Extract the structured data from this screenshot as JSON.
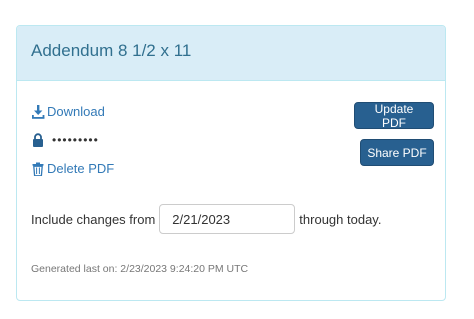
{
  "panel": {
    "title": "Addendum 8 1/2 x 11"
  },
  "links": {
    "download_label": "Download",
    "password_masked": "•••••••••",
    "delete_label": "Delete PDF"
  },
  "buttons": {
    "update_label": "Update PDF",
    "share_label": "Share PDF"
  },
  "changes": {
    "prefix": "Include changes from",
    "date_value": "2/21/2023",
    "suffix": "through today."
  },
  "footer": {
    "generated_text": "Generated last on: 2/23/2023 9:24:20 PM UTC"
  },
  "icons": {
    "download": "download-icon",
    "lock": "lock-icon",
    "trash": "trash-icon"
  },
  "colors": {
    "heading_bg": "#d9edf7",
    "heading_text": "#31708f",
    "border": "#bce8f1",
    "link": "#337ab7",
    "button_bg": "#286090"
  }
}
